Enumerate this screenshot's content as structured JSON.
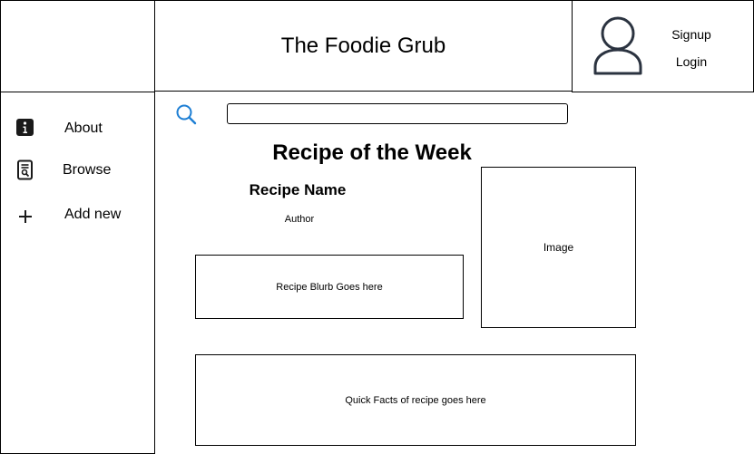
{
  "header": {
    "site_title": "The Foodie Grub",
    "signup_label": "Signup",
    "login_label": "Login"
  },
  "sidebar": {
    "items": [
      {
        "label": "About",
        "icon": "info-icon"
      },
      {
        "label": "Browse",
        "icon": "document-search-icon"
      },
      {
        "label": "Add new",
        "icon": "plus-icon"
      }
    ]
  },
  "search": {
    "icon": "search-icon",
    "value": "",
    "accent_color": "#1e7fd4"
  },
  "main": {
    "section_title": "Recipe of the Week",
    "recipe_name": "Recipe Name",
    "author": "Author",
    "blurb": "Recipe Blurb Goes here",
    "image_label": "Image",
    "quick_facts": "Quick Facts of recipe goes here"
  }
}
